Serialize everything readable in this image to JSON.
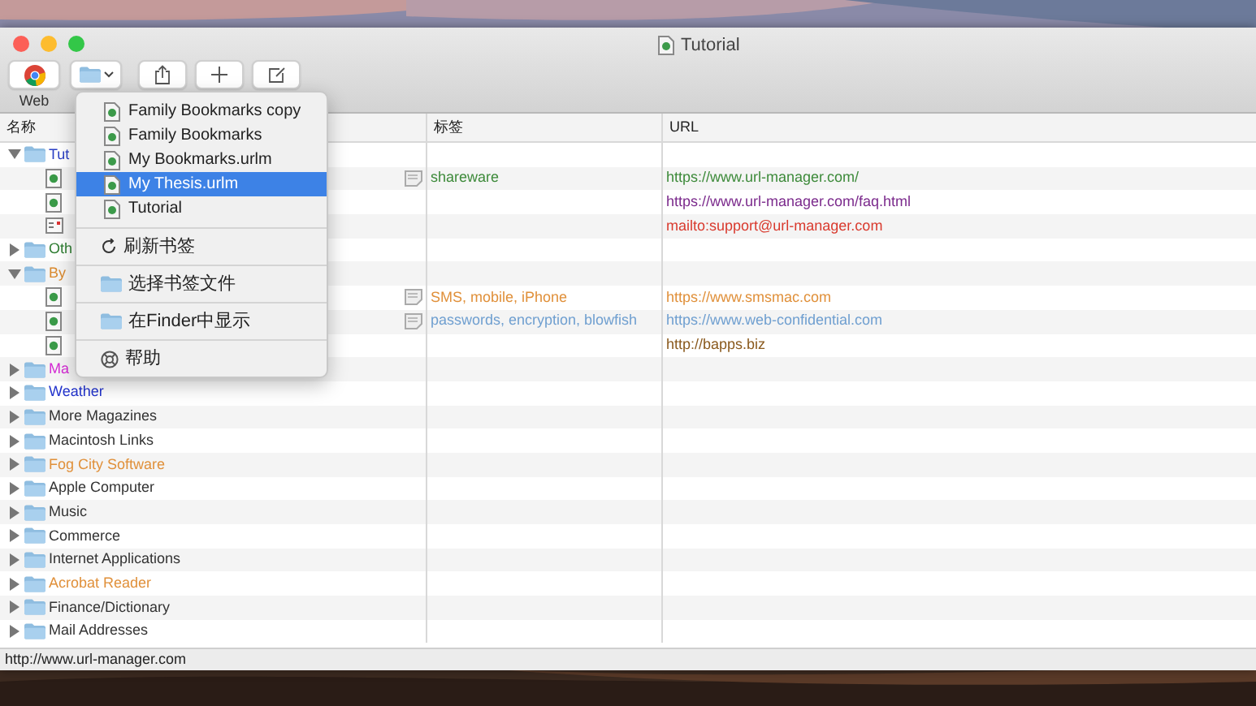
{
  "window": {
    "title": "Tutorial"
  },
  "toolbar": {
    "buttons": [
      {
        "kind": "browser",
        "label": "Web"
      },
      {
        "kind": "folder_menu"
      },
      {
        "kind": "share"
      },
      {
        "kind": "add"
      },
      {
        "kind": "edit"
      }
    ]
  },
  "columns": [
    "名称",
    "标签",
    "URL"
  ],
  "rows": [
    {
      "kind": "folder",
      "name": "Tut",
      "color": "#2a3fc4",
      "expanded": true,
      "children": [
        {
          "kind": "bookmark",
          "note": true,
          "tags": "shareware",
          "url": "https://www.url-manager.com/",
          "color": "#3d8a3a"
        },
        {
          "kind": "bookmark",
          "note": false,
          "url": "https://www.url-manager.com/faq.html",
          "color": "#7b2a8c"
        },
        {
          "kind": "mail",
          "note": false,
          "url": "mailto:support@url-manager.com",
          "color": "#d93a2e"
        }
      ]
    },
    {
      "kind": "folder",
      "name": "Oth",
      "color": "#2e7d32",
      "expanded": false
    },
    {
      "kind": "folder",
      "name": "By",
      "color": "#d9892e",
      "expanded": true,
      "children": [
        {
          "kind": "bookmark",
          "note": true,
          "tags": "SMS, mobile, iPhone",
          "url": "https://www.smsmac.com",
          "color": "#e0903a"
        },
        {
          "kind": "bookmark",
          "note": true,
          "tags": "passwords, encryption, blowfish",
          "url": "https://www.web-confidential.com",
          "color": "#6f9fd0"
        },
        {
          "kind": "bookmark",
          "note": false,
          "url": "http://bapps.biz",
          "color": "#8a5a1e"
        }
      ]
    },
    {
      "kind": "folder",
      "name": "Ma",
      "color": "#d42ad4",
      "expanded": false
    },
    {
      "kind": "folder",
      "name": "Weather",
      "color": "#2233cc",
      "expanded": false
    },
    {
      "kind": "folder",
      "name": "More Magazines",
      "color": "#333333",
      "expanded": false
    },
    {
      "kind": "folder",
      "name": "Macintosh Links",
      "color": "#333333",
      "expanded": false
    },
    {
      "kind": "folder",
      "name": "Fog City Software",
      "color": "#e0903a",
      "expanded": false
    },
    {
      "kind": "folder",
      "name": "Apple Computer",
      "color": "#333333",
      "expanded": false
    },
    {
      "kind": "folder",
      "name": "Music",
      "color": "#333333",
      "expanded": false
    },
    {
      "kind": "folder",
      "name": "Commerce",
      "color": "#333333",
      "expanded": false
    },
    {
      "kind": "folder",
      "name": "Internet Applications",
      "color": "#333333",
      "expanded": false
    },
    {
      "kind": "folder",
      "name": "Acrobat Reader",
      "color": "#e0903a",
      "expanded": false
    },
    {
      "kind": "folder",
      "name": "Finance/Dictionary",
      "color": "#333333",
      "expanded": false
    },
    {
      "kind": "folder",
      "name": "Mail Addresses",
      "color": "#333333",
      "expanded": false
    }
  ],
  "menu": {
    "files": [
      {
        "label": "Family Bookmarks copy",
        "selected": false
      },
      {
        "label": "Family Bookmarks",
        "selected": false
      },
      {
        "label": "My Bookmarks.urlm",
        "selected": false
      },
      {
        "label": "My Thesis.urlm",
        "selected": true
      },
      {
        "label": "Tutorial",
        "selected": false
      }
    ],
    "actions": [
      {
        "kind": "refresh",
        "label": "刷新书签"
      },
      {
        "kind": "folder",
        "label": "选择书签文件"
      },
      {
        "kind": "folder",
        "label": "在Finder中显示"
      },
      {
        "kind": "help",
        "label": "帮助"
      }
    ]
  },
  "status_bar": "http://www.url-manager.com"
}
